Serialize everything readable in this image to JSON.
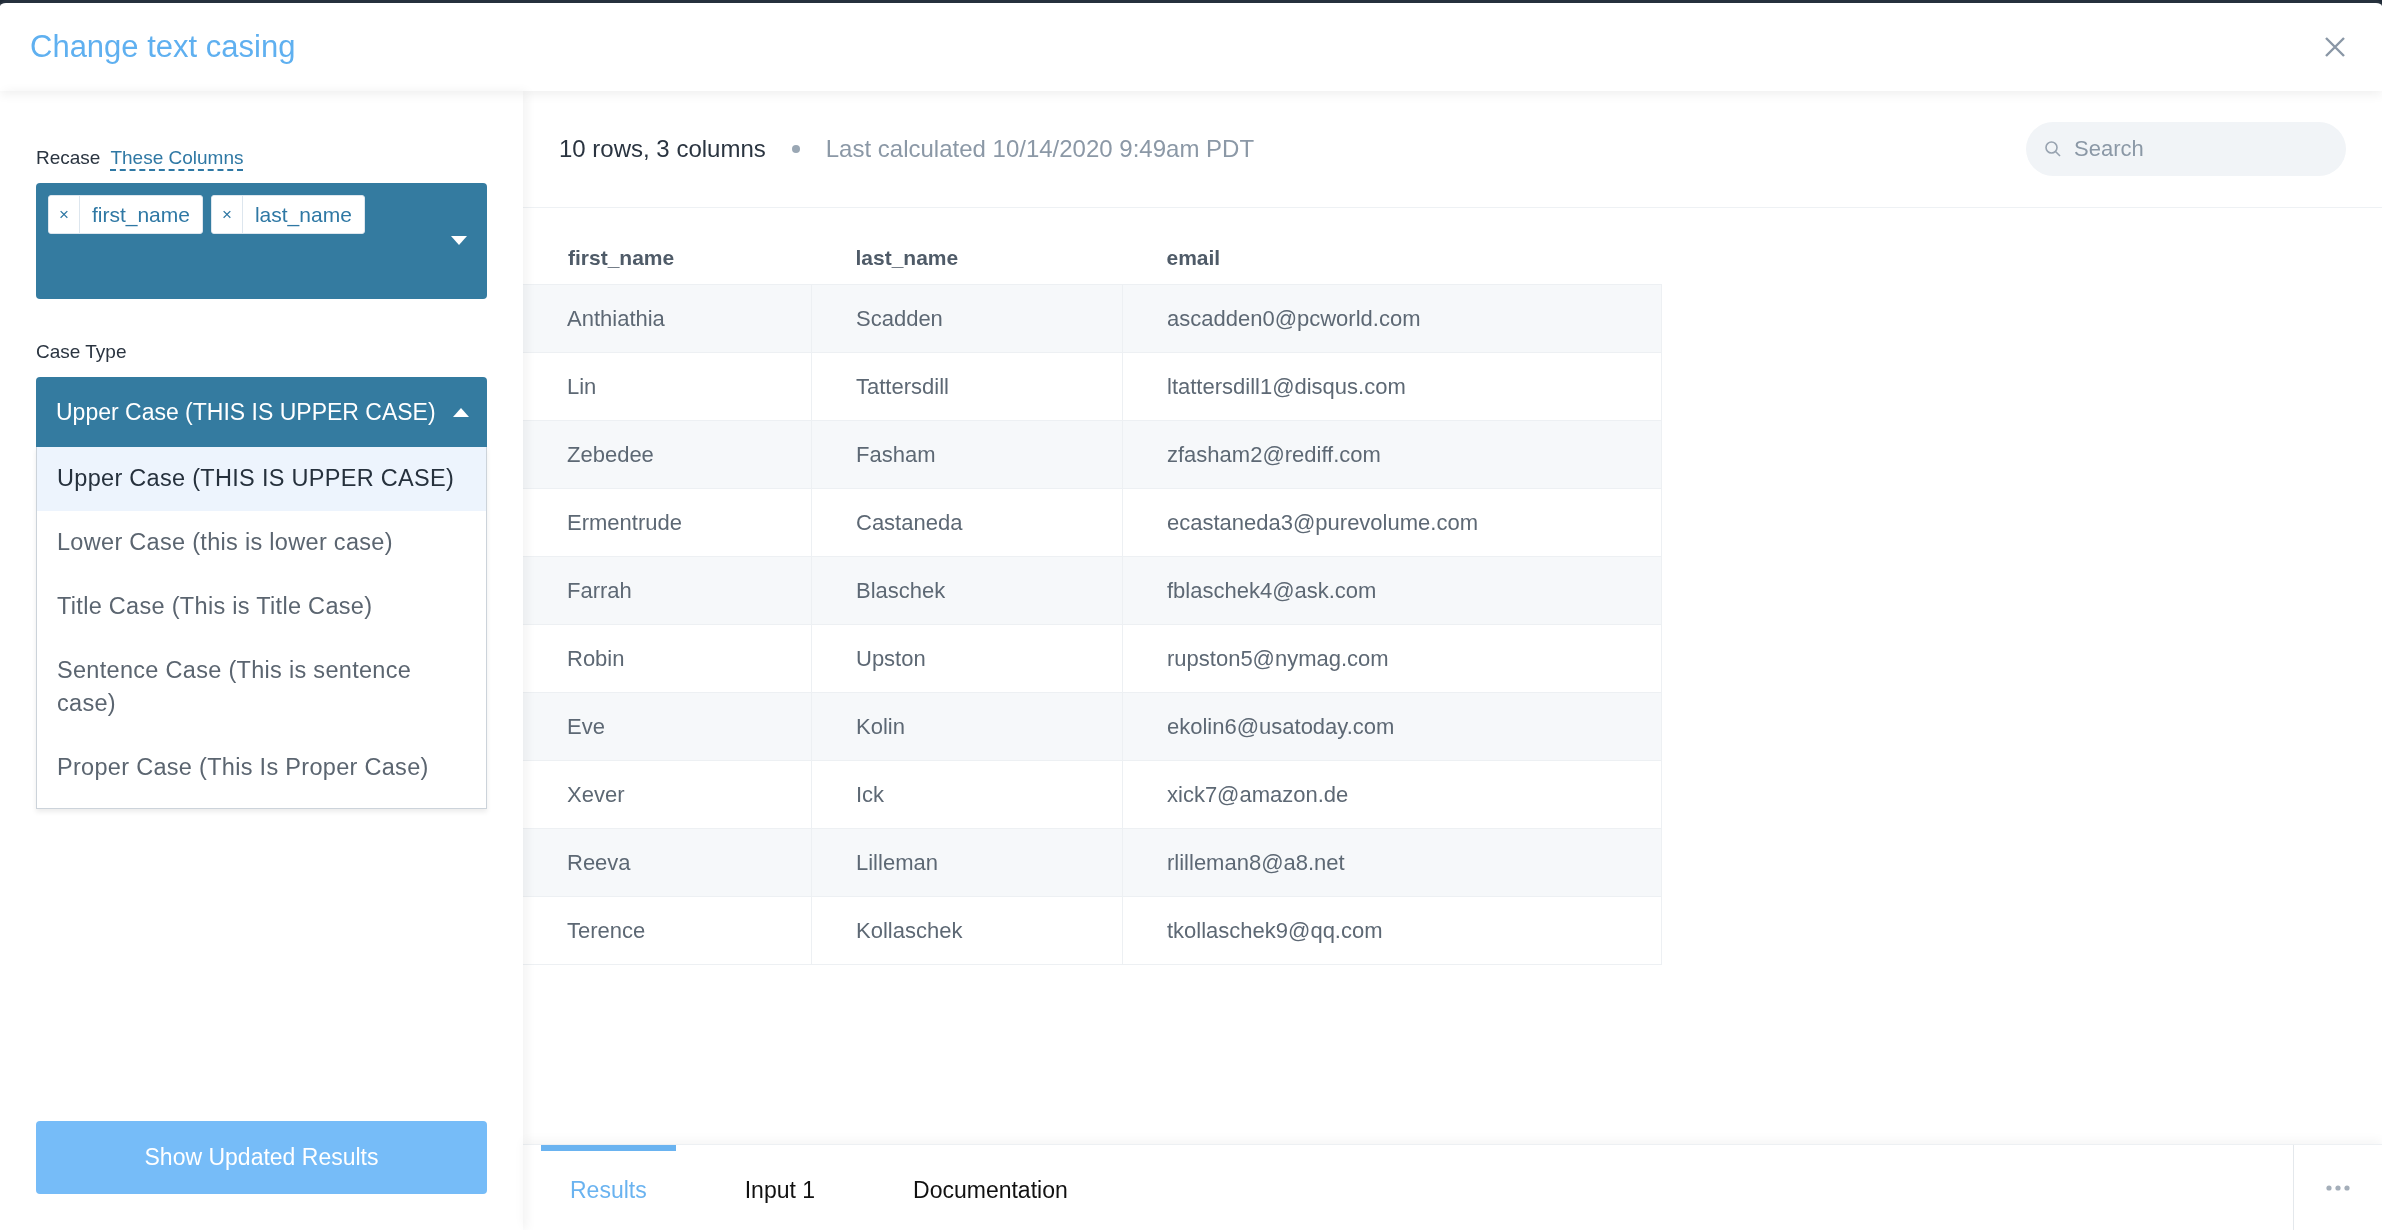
{
  "window": {
    "title": "Change text casing"
  },
  "sidebar": {
    "recase_label": "Recase",
    "columns_link": "These Columns",
    "selected_columns": [
      {
        "remove": "×",
        "label": "first_name"
      },
      {
        "remove": "×",
        "label": "last_name"
      }
    ],
    "case_type_label": "Case Type",
    "case_type_value": "Upper Case (THIS IS UPPER CASE)",
    "case_type_expanded": true,
    "case_options": [
      {
        "label": "Upper Case (THIS IS UPPER CASE)",
        "selected": true
      },
      {
        "label": "Lower Case (this is lower case)",
        "selected": false
      },
      {
        "label": "Title Case (This is Title Case)",
        "selected": false
      },
      {
        "label": "Sentence Case (This is sentence case)",
        "selected": false
      },
      {
        "label": "Proper Case (This Is Proper Case)",
        "selected": false
      }
    ],
    "submit_button": "Show Updated Results"
  },
  "results": {
    "summary": "10 rows, 3 columns",
    "last_calculated": "Last calculated 10/14/2020 9:49am PDT",
    "search": {
      "placeholder": "Search"
    },
    "table": {
      "columns": [
        "first_name",
        "last_name",
        "email"
      ],
      "rows": [
        [
          "Anthiathia",
          "Scadden",
          "ascadden0@pcworld.com"
        ],
        [
          "Lin",
          "Tattersdill",
          "ltattersdill1@disqus.com"
        ],
        [
          "Zebedee",
          "Fasham",
          "zfasham2@rediff.com"
        ],
        [
          "Ermentrude",
          "Castaneda",
          "ecastaneda3@purevolume.com"
        ],
        [
          "Farrah",
          "Blaschek",
          "fblaschek4@ask.com"
        ],
        [
          "Robin",
          "Upston",
          "rupston5@nymag.com"
        ],
        [
          "Eve",
          "Kolin",
          "ekolin6@usatoday.com"
        ],
        [
          "Xever",
          "Ick",
          "xick7@amazon.de"
        ],
        [
          "Reeva",
          "Lilleman",
          "rlilleman8@a8.net"
        ],
        [
          "Terence",
          "Kollaschek",
          "tkollaschek9@qq.com"
        ]
      ]
    },
    "tabs": [
      {
        "label": "Results",
        "selected": true
      },
      {
        "label": "Input 1",
        "selected": false
      },
      {
        "label": "Documentation",
        "selected": false
      }
    ]
  }
}
